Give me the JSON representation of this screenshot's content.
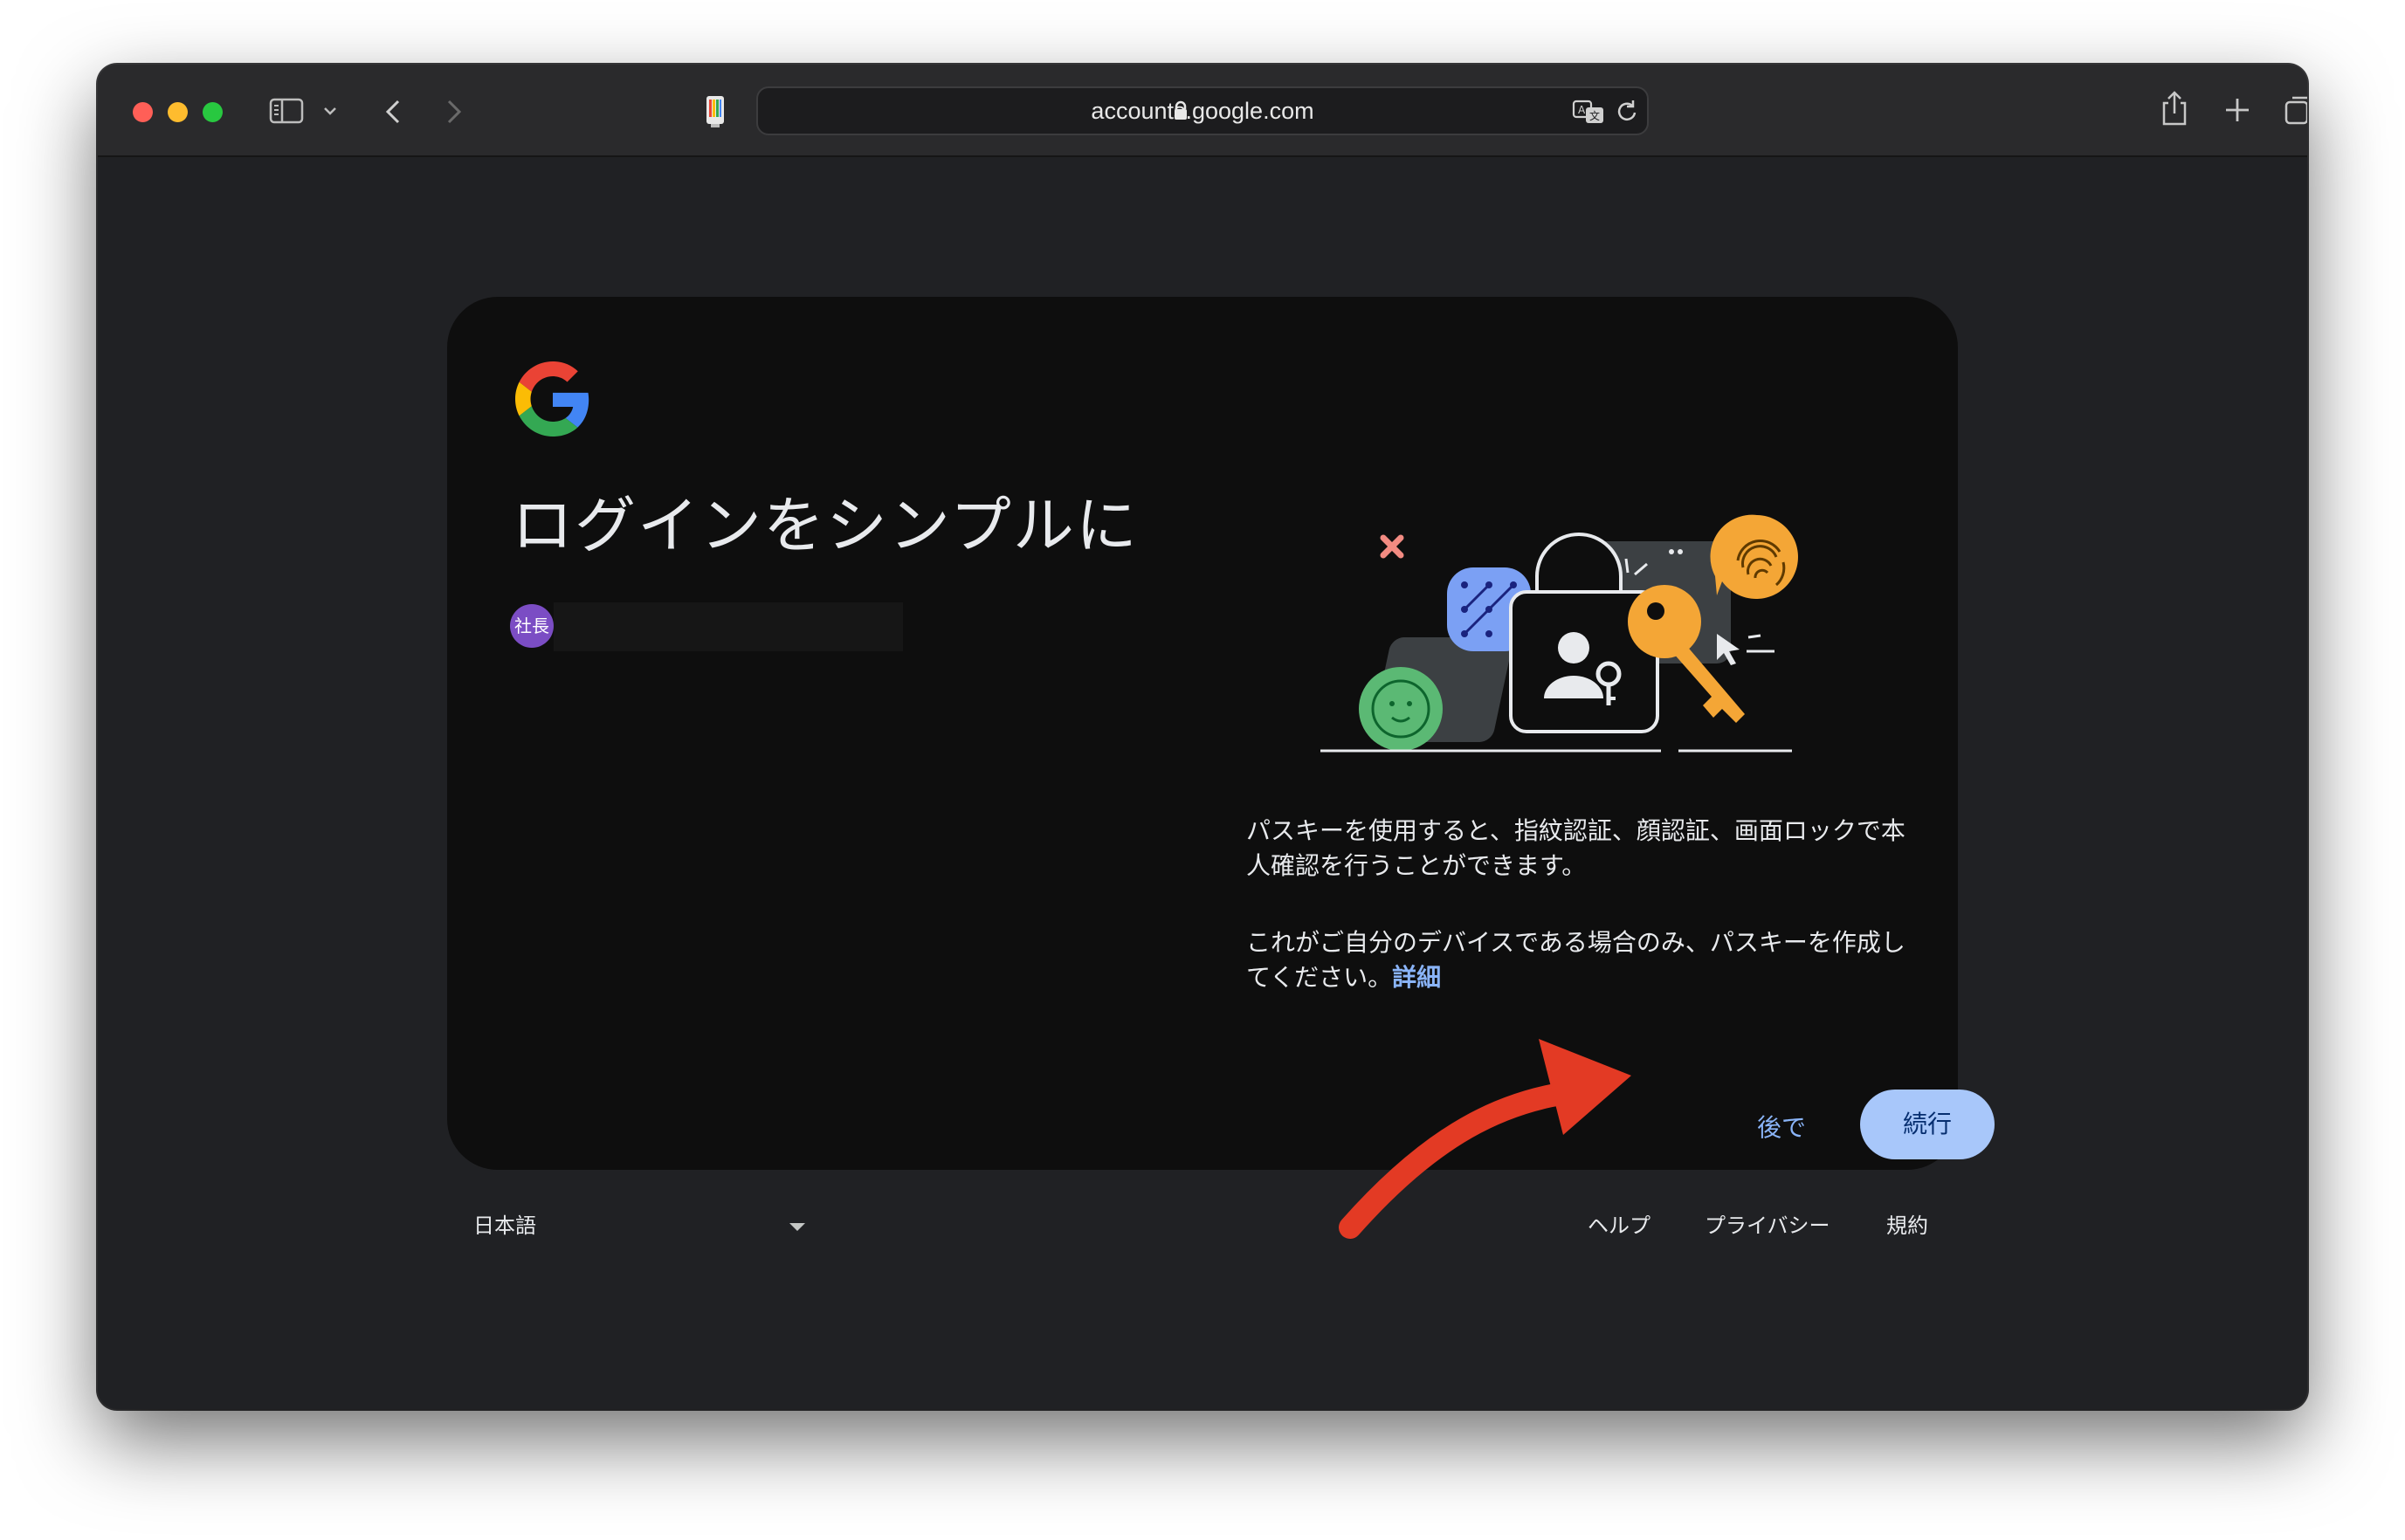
{
  "browser": {
    "url": "accounts.google.com",
    "icons": [
      "sidebar-icon",
      "chevron-down-icon",
      "back-icon",
      "forward-icon",
      "page-favicon",
      "lock-icon",
      "translate-icon",
      "reload-icon",
      "share-icon",
      "new-tab-icon",
      "tab-overview-icon"
    ]
  },
  "card": {
    "logo": "google-logo",
    "title": "ログインをシンプルに",
    "account_avatar_text": "社長",
    "body_line1": "パスキーを使用すると、指紋認証、顔認証、画面ロックで本人確認を行うことができます。",
    "body_line2": "これがご自分のデバイスである場合のみ、パスキーを作成してください。",
    "learn_more": "詳細",
    "later_button": "後で",
    "continue_button": "続行"
  },
  "footer": {
    "language": "日本語",
    "help": "ヘルプ",
    "privacy": "プライバシー",
    "terms": "規約"
  },
  "colors": {
    "accent": "#8ab4f8",
    "primary_button": "#a8c7fa",
    "annotation_arrow": "#e33a24"
  }
}
